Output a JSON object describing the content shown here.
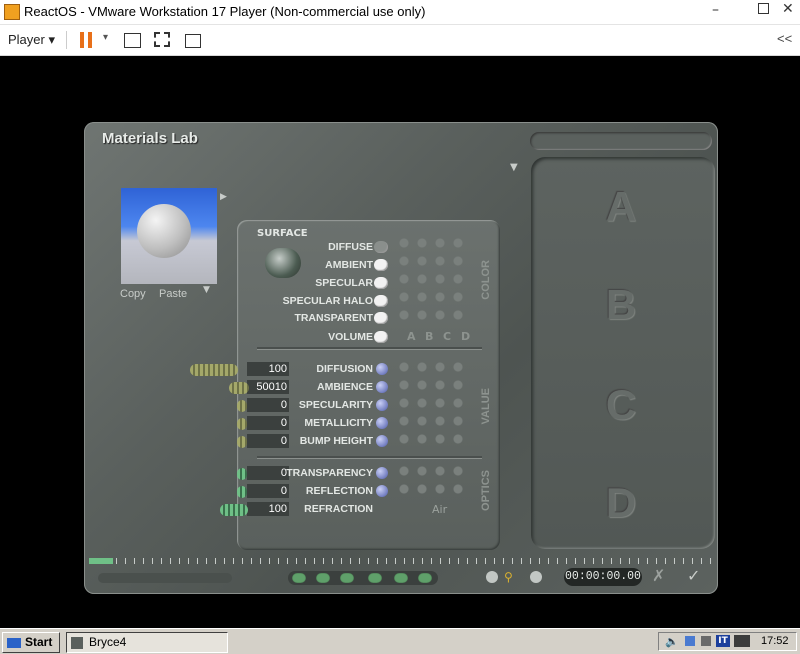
{
  "vmware": {
    "title": "ReactOS - VMware Workstation 17 Player (Non-commercial use only)",
    "menu_player": "Player",
    "collapse_label": "<<"
  },
  "bryce": {
    "title": "Materials Lab",
    "preview": {
      "copy": "Copy",
      "paste": "Paste"
    },
    "surface_label": "SURFACE",
    "color_rows": [
      {
        "label": "DIFFUSE",
        "on": false
      },
      {
        "label": "AMBIENT",
        "on": true
      },
      {
        "label": "SPECULAR",
        "on": true
      },
      {
        "label": "SPECULAR HALO",
        "on": true
      },
      {
        "label": "TRANSPARENT",
        "on": true
      },
      {
        "label": "VOLUME",
        "on": true
      }
    ],
    "column_letters": [
      "A",
      "B",
      "C",
      "D"
    ],
    "color_tag": "COLOR",
    "value_rows": [
      {
        "label": "DIFFUSION",
        "value": "100"
      },
      {
        "label": "AMBIENCE",
        "value": "50010"
      },
      {
        "label": "SPECULARITY",
        "value": "0"
      },
      {
        "label": "METALLICITY",
        "value": "0"
      },
      {
        "label": "BUMP HEIGHT",
        "value": "0"
      }
    ],
    "value_tag": "VALUE",
    "optics_rows": [
      {
        "label": "TRANSPARENCY",
        "value": "0"
      },
      {
        "label": "REFLECTION",
        "value": "0"
      },
      {
        "label": "REFRACTION",
        "value": "100"
      }
    ],
    "optics_tag": "OPTICS",
    "refraction_preset": "Air",
    "slots": [
      "A",
      "B",
      "C",
      "D"
    ],
    "time": "00:00:00.00"
  },
  "taskbar": {
    "start": "Start",
    "task": "Bryce4",
    "lang": "IT",
    "clock": "17:52"
  }
}
